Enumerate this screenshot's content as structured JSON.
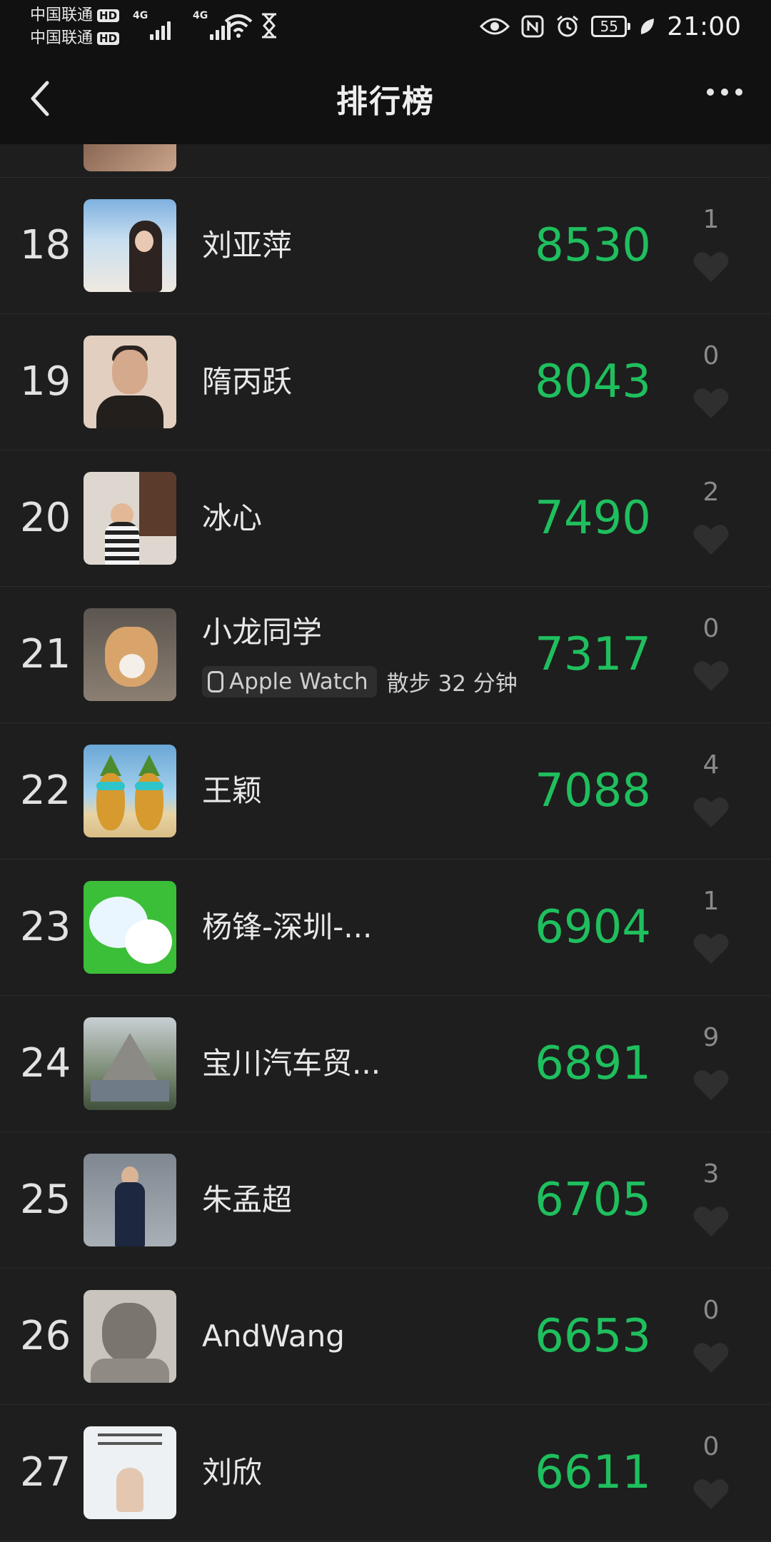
{
  "status_bar": {
    "carrier1": "中国联通",
    "carrier2": "中国联通",
    "hd_badge": "HD",
    "network1": "4G",
    "network2": "4G",
    "battery": "55",
    "time": "21:00"
  },
  "header": {
    "title": "排行榜"
  },
  "rows": [
    {
      "rank": "18",
      "name": "刘亚萍",
      "steps": "8530",
      "likes": "1"
    },
    {
      "rank": "19",
      "name": "隋丙跃",
      "steps": "8043",
      "likes": "0"
    },
    {
      "rank": "20",
      "name": "冰心",
      "steps": "7490",
      "likes": "2"
    },
    {
      "rank": "21",
      "name": "小龙同学",
      "device": "Apple Watch",
      "activity": "散步 32 分钟",
      "steps": "7317",
      "likes": "0"
    },
    {
      "rank": "22",
      "name": "王颖",
      "steps": "7088",
      "likes": "4"
    },
    {
      "rank": "23",
      "name": "杨锋-深圳-...",
      "steps": "6904",
      "likes": "1"
    },
    {
      "rank": "24",
      "name": "宝川汽车贸...",
      "steps": "6891",
      "likes": "9"
    },
    {
      "rank": "25",
      "name": "朱孟超",
      "steps": "6705",
      "likes": "3"
    },
    {
      "rank": "26",
      "name": "AndWang",
      "steps": "6653",
      "likes": "0"
    },
    {
      "rank": "27",
      "name": "刘欣",
      "steps": "6611",
      "likes": "0"
    }
  ],
  "colors": {
    "steps": "#1fbf5e",
    "background": "#1e1e1e",
    "bar": "#111111"
  },
  "icons": {
    "back": "chevron-left-icon",
    "more": "more-icon",
    "like": "heart-icon"
  }
}
